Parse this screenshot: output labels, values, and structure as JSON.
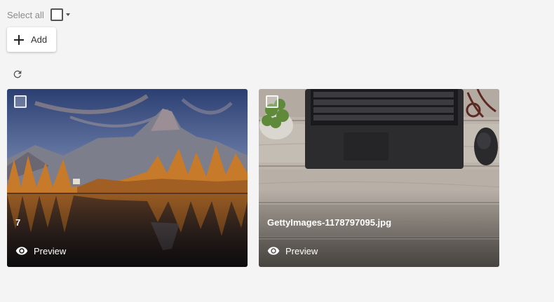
{
  "toolbar": {
    "select_all_label": "Select all",
    "add_label": "Add"
  },
  "icons": {
    "add": "plus-icon",
    "refresh": "refresh-icon",
    "preview": "eye-icon",
    "select_dropdown": "caret-down-icon"
  },
  "cards": [
    {
      "title": "7",
      "preview_label": "Preview"
    },
    {
      "title": "GettyImages-1178797095.jpg",
      "preview_label": "Preview"
    }
  ]
}
